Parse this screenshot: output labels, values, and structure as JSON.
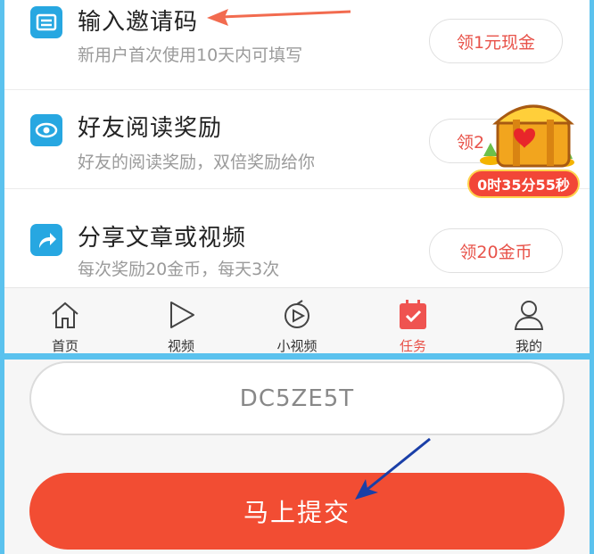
{
  "tasks": [
    {
      "title": "输入邀请码",
      "subtitle": "新用户首次使用10天内可填写",
      "button": "领1元现金",
      "icon": "ticket-icon"
    },
    {
      "title": "好友阅读奖励",
      "subtitle": "好友的阅读奖励，双倍奖励给你",
      "button": "领2",
      "icon": "eye-icon"
    },
    {
      "title": "分享文章或视频",
      "subtitle": "每次奖励20金币，每天3次",
      "button": "领20金币",
      "icon": "share-icon"
    }
  ],
  "chest": {
    "timer": "0时35分55秒",
    "icon": "treasure-chest-icon"
  },
  "tabbar": {
    "items": [
      {
        "label": "首页",
        "icon": "home-icon"
      },
      {
        "label": "视频",
        "icon": "play-icon"
      },
      {
        "label": "小视频",
        "icon": "short-video-icon"
      },
      {
        "label": "任务",
        "icon": "calendar-check-icon",
        "active": true
      },
      {
        "label": "我的",
        "icon": "user-icon"
      }
    ]
  },
  "invite": {
    "code_value": "DC5ZE5T",
    "submit_label": "马上提交"
  },
  "colors": {
    "accent": "#e8534a",
    "submit_bg": "#f24d33",
    "icon_blue": "#27a7e1",
    "border_blue": "#5bc2ee"
  }
}
